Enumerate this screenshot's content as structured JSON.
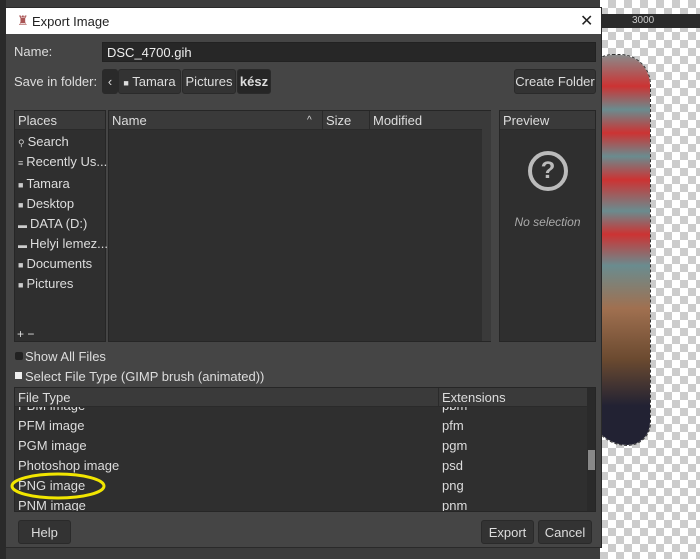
{
  "background": {
    "ruler_label": "3000"
  },
  "dialog": {
    "title": "Export Image",
    "name_label": "Name:",
    "name_value": "DSC_4700.gih",
    "folder_label": "Save in folder:",
    "breadcrumb": [
      "Tamara",
      "Pictures",
      "kész"
    ],
    "create_folder": "Create Folder",
    "places": {
      "header": "Places",
      "items": [
        {
          "label": "Search",
          "icon": "search-icon"
        },
        {
          "label": "Recently Us...",
          "icon": "recent-icon"
        },
        {
          "label": "Tamara",
          "icon": "folder-icon"
        },
        {
          "label": "Desktop",
          "icon": "folder-icon"
        },
        {
          "label": "DATA (D:)",
          "icon": "drive-icon"
        },
        {
          "label": "Helyi lemez...",
          "icon": "drive-icon"
        },
        {
          "label": "Documents",
          "icon": "folder-icon"
        },
        {
          "label": "Pictures",
          "icon": "folder-icon"
        }
      ],
      "add": "+",
      "remove": "−"
    },
    "files": {
      "col_name": "Name",
      "col_size": "Size",
      "col_modified": "Modified"
    },
    "preview": {
      "header": "Preview",
      "empty": "No selection"
    },
    "show_all_files": "Show All Files",
    "select_file_type": "Select File Type (GIMP brush (animated))",
    "file_types": {
      "col_type": "File Type",
      "col_ext": "Extensions",
      "rows": [
        {
          "type": "PBM image",
          "ext": "pbm"
        },
        {
          "type": "PFM image",
          "ext": "pfm"
        },
        {
          "type": "PGM image",
          "ext": "pgm"
        },
        {
          "type": "Photoshop image",
          "ext": "psd"
        },
        {
          "type": "PNG image",
          "ext": "png"
        },
        {
          "type": "PNM image",
          "ext": "pnm"
        }
      ]
    },
    "help": "Help",
    "export": "Export",
    "cancel": "Cancel",
    "highlight_color": "#f2e600"
  }
}
